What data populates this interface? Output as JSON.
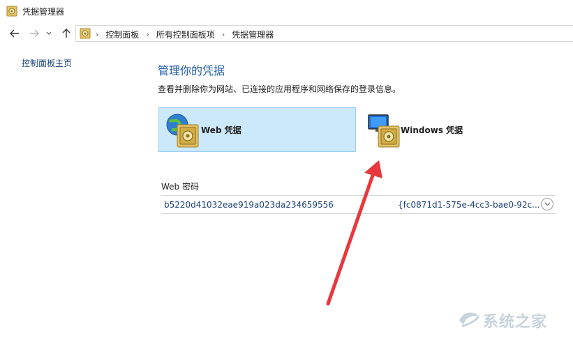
{
  "window": {
    "title": "凭据管理器"
  },
  "address": {
    "crumbs": [
      "控制面板",
      "所有控制面板项",
      "凭据管理器"
    ]
  },
  "sidebar": {
    "home_link": "控制面板主页"
  },
  "main": {
    "title": "管理你的凭据",
    "description": "查看并删除你为网站、已连接的应用程序和网络保存的登录信息。",
    "tiles": [
      {
        "label": "Web 凭据",
        "selected": true
      },
      {
        "label": "Windows 凭据",
        "selected": false
      }
    ],
    "section_title": "Web 密码",
    "credentials": [
      {
        "name": "b5220d41032eae919a023da234659556",
        "id": "{fc0871d1-575e-4cc3-bae0-92c..."
      }
    ]
  },
  "watermark": {
    "text": "系统之家"
  },
  "colors": {
    "accent": "#1e5aa6",
    "link": "#1a3f7a",
    "selected_bg": "#cce8fb",
    "selected_border": "#99d1f5",
    "arrow": "#e8383d"
  }
}
